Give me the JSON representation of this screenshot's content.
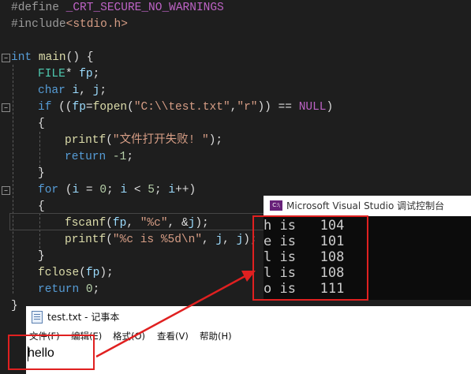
{
  "editor": {
    "lines": {
      "l1": {
        "a": "#define ",
        "b": "_CRT_SECURE_NO_WARNINGS"
      },
      "l2": {
        "a": "#include",
        "b": "<stdio.h>"
      },
      "l4": {
        "a": "int ",
        "b": "main",
        "c": "() {"
      },
      "l5": {
        "a": "FILE",
        "b": "* ",
        "c": "fp",
        "d": ";"
      },
      "l6": {
        "a": "char ",
        "b": "i",
        "c": ", ",
        "d": "j",
        "e": ";"
      },
      "l7": {
        "a": "if ",
        "b": "((",
        "c": "fp",
        "d": "=",
        "e": "fopen",
        "f": "(",
        "g": "\"C:\\\\test.txt\"",
        "h": ",",
        "i": "\"r\"",
        "j": ")) == ",
        "k": "NULL",
        "l": ")"
      },
      "l8": {
        "a": "{"
      },
      "l9": {
        "a": "printf",
        "b": "(",
        "c": "\"文件打开失败! \"",
        "d": ");"
      },
      "l10": {
        "a": "return ",
        "b": "-1",
        "c": ";"
      },
      "l11": {
        "a": "}"
      },
      "l12": {
        "a": "for ",
        "b": "(",
        "c": "i",
        "d": " = ",
        "e": "0",
        "f": "; ",
        "g": "i",
        "h": " < ",
        "i": "5",
        "j": "; ",
        "k": "i",
        "l": "++)"
      },
      "l13": {
        "a": "{"
      },
      "l14": {
        "a": "fscanf",
        "b": "(",
        "c": "fp",
        "d": ", ",
        "e": "\"%c\"",
        "f": ", &",
        "g": "j",
        "h": ");"
      },
      "l15": {
        "a": "printf",
        "b": "(",
        "c": "\"%c is %5d\\n\"",
        "d": ", ",
        "e": "j",
        "f": ", ",
        "g": "j",
        "h": ");"
      },
      "l16": {
        "a": "}"
      },
      "l17": {
        "a": "fclose",
        "b": "(",
        "c": "fp",
        "d": ");"
      },
      "l18": {
        "a": "return ",
        "b": "0",
        "c": ";"
      },
      "l19": {
        "a": "}"
      }
    },
    "fold_glyph": "−"
  },
  "console": {
    "title": "Microsoft Visual Studio 调试控制台",
    "icon_label": "C:\\",
    "lines": [
      "h is   104",
      "e is   101",
      "l is   108",
      "l is   108",
      "o is   111"
    ]
  },
  "notepad": {
    "title": "test.txt - 记事本",
    "menu": [
      "文件(F)",
      "编辑(E)",
      "格式(O)",
      "查看(V)",
      "帮助(H)"
    ],
    "content": "hello"
  },
  "colors": {
    "highlight_box": "#e02020",
    "editor_bg": "#1e1e1e",
    "console_bg": "#0c0c0c"
  }
}
